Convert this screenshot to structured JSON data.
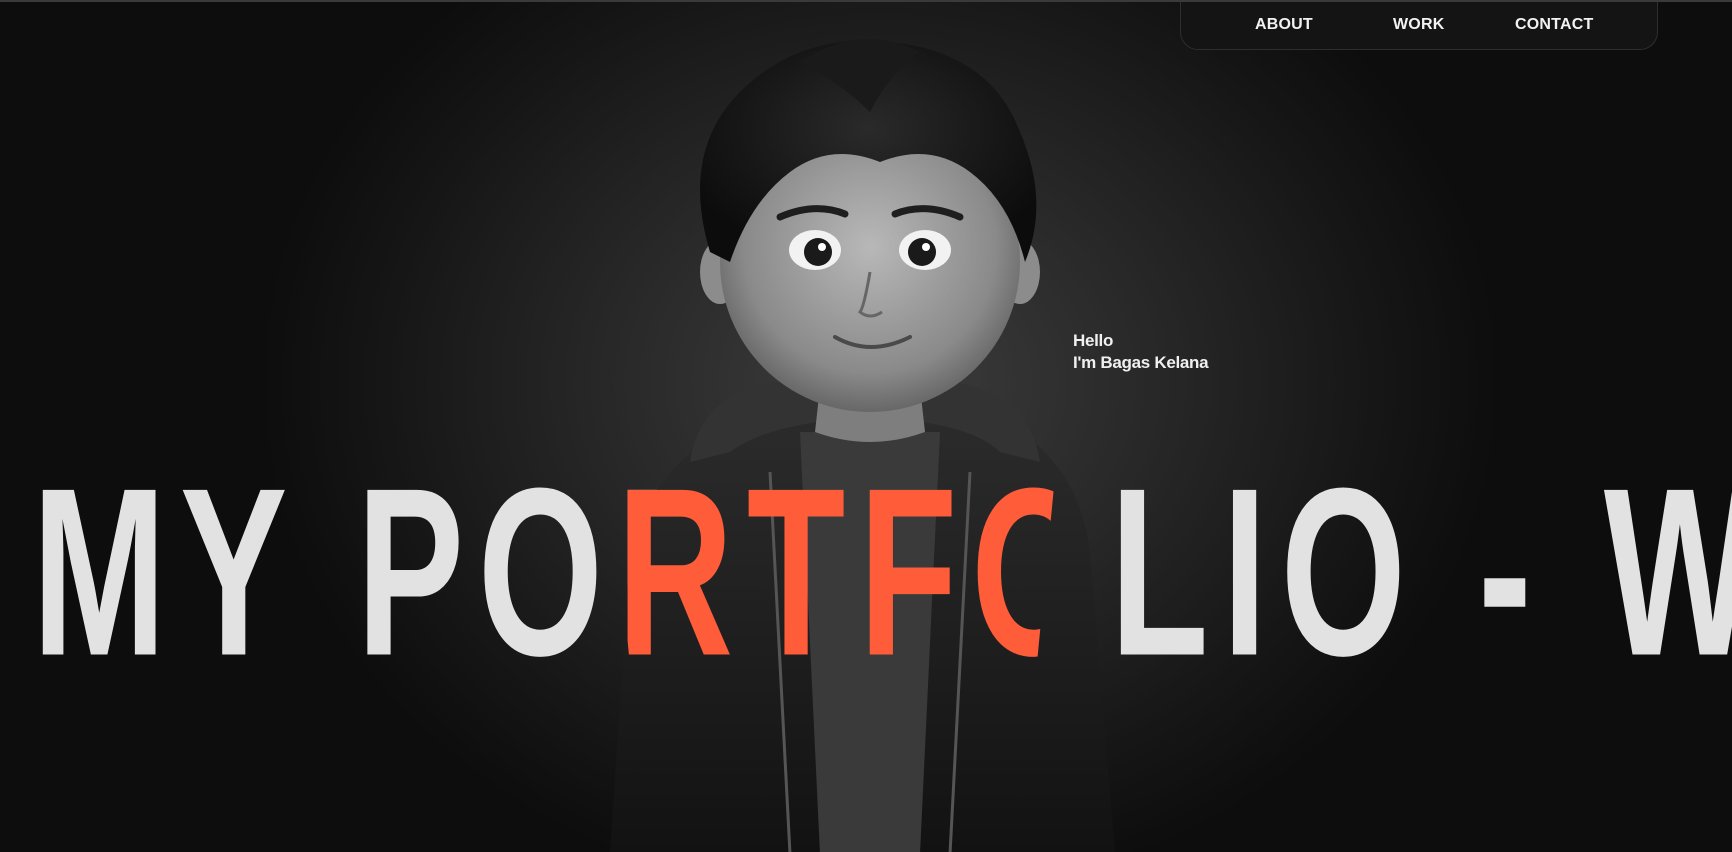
{
  "nav": {
    "items": [
      {
        "label": "ABOUT"
      },
      {
        "label": "WORK"
      },
      {
        "label": "CONTACT"
      }
    ]
  },
  "hero": {
    "greeting_line1": "Hello",
    "greeting_line2": "I'm Bagas Kelana",
    "marquee_text": "MY PORTFOLIO - WE"
  },
  "colors": {
    "background": "#1e1e1e",
    "marquee_text": "#e2e2e2",
    "accent": "#ff5c3a"
  }
}
